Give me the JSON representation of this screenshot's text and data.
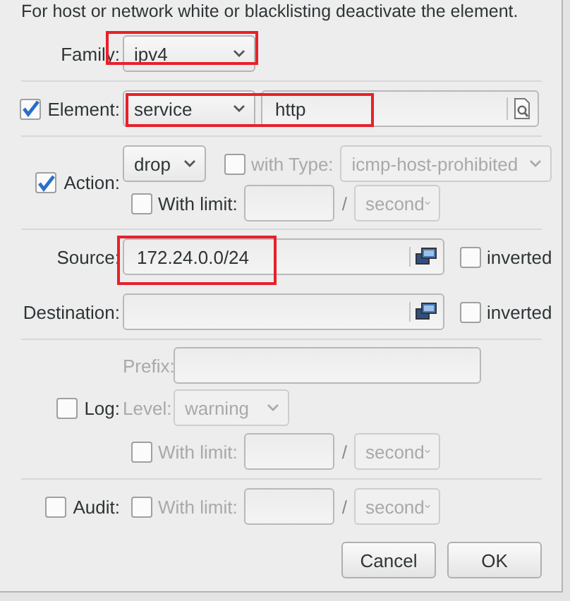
{
  "intro": "For host or network white or blacklisting deactivate the element.",
  "family": {
    "label": "Family:",
    "value": "ipv4",
    "highlighted": true
  },
  "element": {
    "label": "Element:",
    "checked": true,
    "type": "service",
    "value": "http",
    "highlighted": true
  },
  "action": {
    "label": "Action:",
    "checked": true,
    "value": "drop",
    "with_type": {
      "label": "with Type:",
      "checked": false,
      "value": "icmp-host-prohibited",
      "disabled": true
    },
    "limit": {
      "label": "With limit:",
      "checked": false,
      "separator": "/",
      "unit": "second",
      "disabled": false
    }
  },
  "source": {
    "label": "Source:",
    "value": "172.24.0.0/24",
    "highlighted": true,
    "inverted": {
      "label": "inverted",
      "checked": false
    }
  },
  "destination": {
    "label": "Destination:",
    "inverted": {
      "label": "inverted",
      "checked": false
    }
  },
  "log": {
    "label": "Log:",
    "checked": false,
    "prefix_label": "Prefix:",
    "level_label": "Level:",
    "level_value": "warning",
    "disabled": true,
    "limit": {
      "label": "With limit:",
      "checked": false,
      "separator": "/",
      "unit": "second",
      "disabled": true
    }
  },
  "audit": {
    "label": "Audit:",
    "checked": false,
    "limit": {
      "label": "With limit:",
      "checked": false,
      "separator": "/",
      "unit": "second",
      "disabled": true
    }
  },
  "buttons": [
    {
      "label": "Cancel"
    },
    {
      "label": "OK"
    }
  ]
}
